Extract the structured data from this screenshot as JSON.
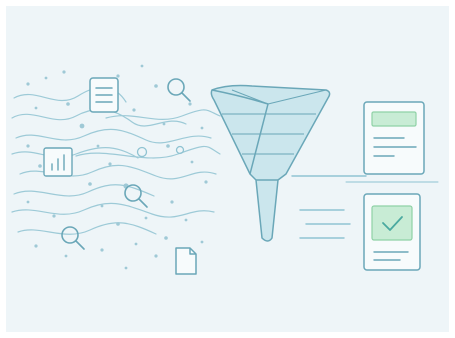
{
  "colors": {
    "background": "#eef5f8",
    "line": "#8fc3d2",
    "line_dark": "#6aa7b8",
    "dot": "#9fc9d6",
    "funnel_fill": "#bfe0ea",
    "document_fill": "#f7fbfc",
    "accent_green": "#c8ecd5",
    "accent_green_stroke": "#8fd1a6",
    "check": "#4aa9a0"
  },
  "illustration": {
    "icons": [
      "document-icon",
      "search-icon",
      "bar-chart-icon",
      "search-icon",
      "search-icon",
      "file-icon",
      "funnel-icon",
      "report-card-icon",
      "approved-card-icon",
      "check-icon"
    ]
  }
}
